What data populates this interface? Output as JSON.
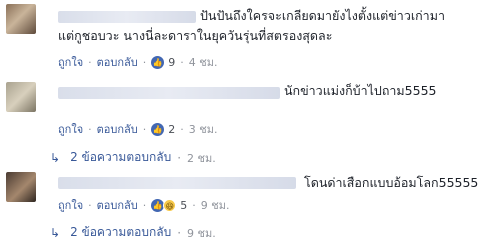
{
  "comments": [
    {
      "text_line1": "ปันปันถึงใครจะเกลียดมายังไงตั้งแต่ข่าวเก่ามา",
      "text_line2": "แต่กูชอบวะ นางนี่ละดาราในยุควันรุ่นที่สตรองสุดละ",
      "like_label": "ถูกใจ",
      "reply_label": "ตอบกลับ",
      "reactions": "9",
      "time": "4 ชม."
    },
    {
      "text": "นักข่าวแม่งก็บ้าไปถาม5555",
      "like_label": "ถูกใจ",
      "reply_label": "ตอบกลับ",
      "reactions": "2",
      "time": "3 ชม.",
      "replies_label": "2 ข้อความตอบกลับ",
      "replies_time": "2 ชม."
    },
    {
      "text": "โดนด่าเสือกแบบอ้อมโลก55555",
      "like_label": "ถูกใจ",
      "reply_label": "ตอบกลับ",
      "reactions": "5",
      "time": "9 ชม.",
      "replies_label": "2 ข้อความตอบกลับ",
      "replies_time": "9 ชม."
    }
  ],
  "icons": {
    "like": "thumbs-up-icon",
    "haha": "haha-icon",
    "reply_arrow": "reply-arrow-icon"
  },
  "colors": {
    "link": "#385898",
    "like_badge": "#4267b2",
    "meta_gray": "#90949c"
  }
}
